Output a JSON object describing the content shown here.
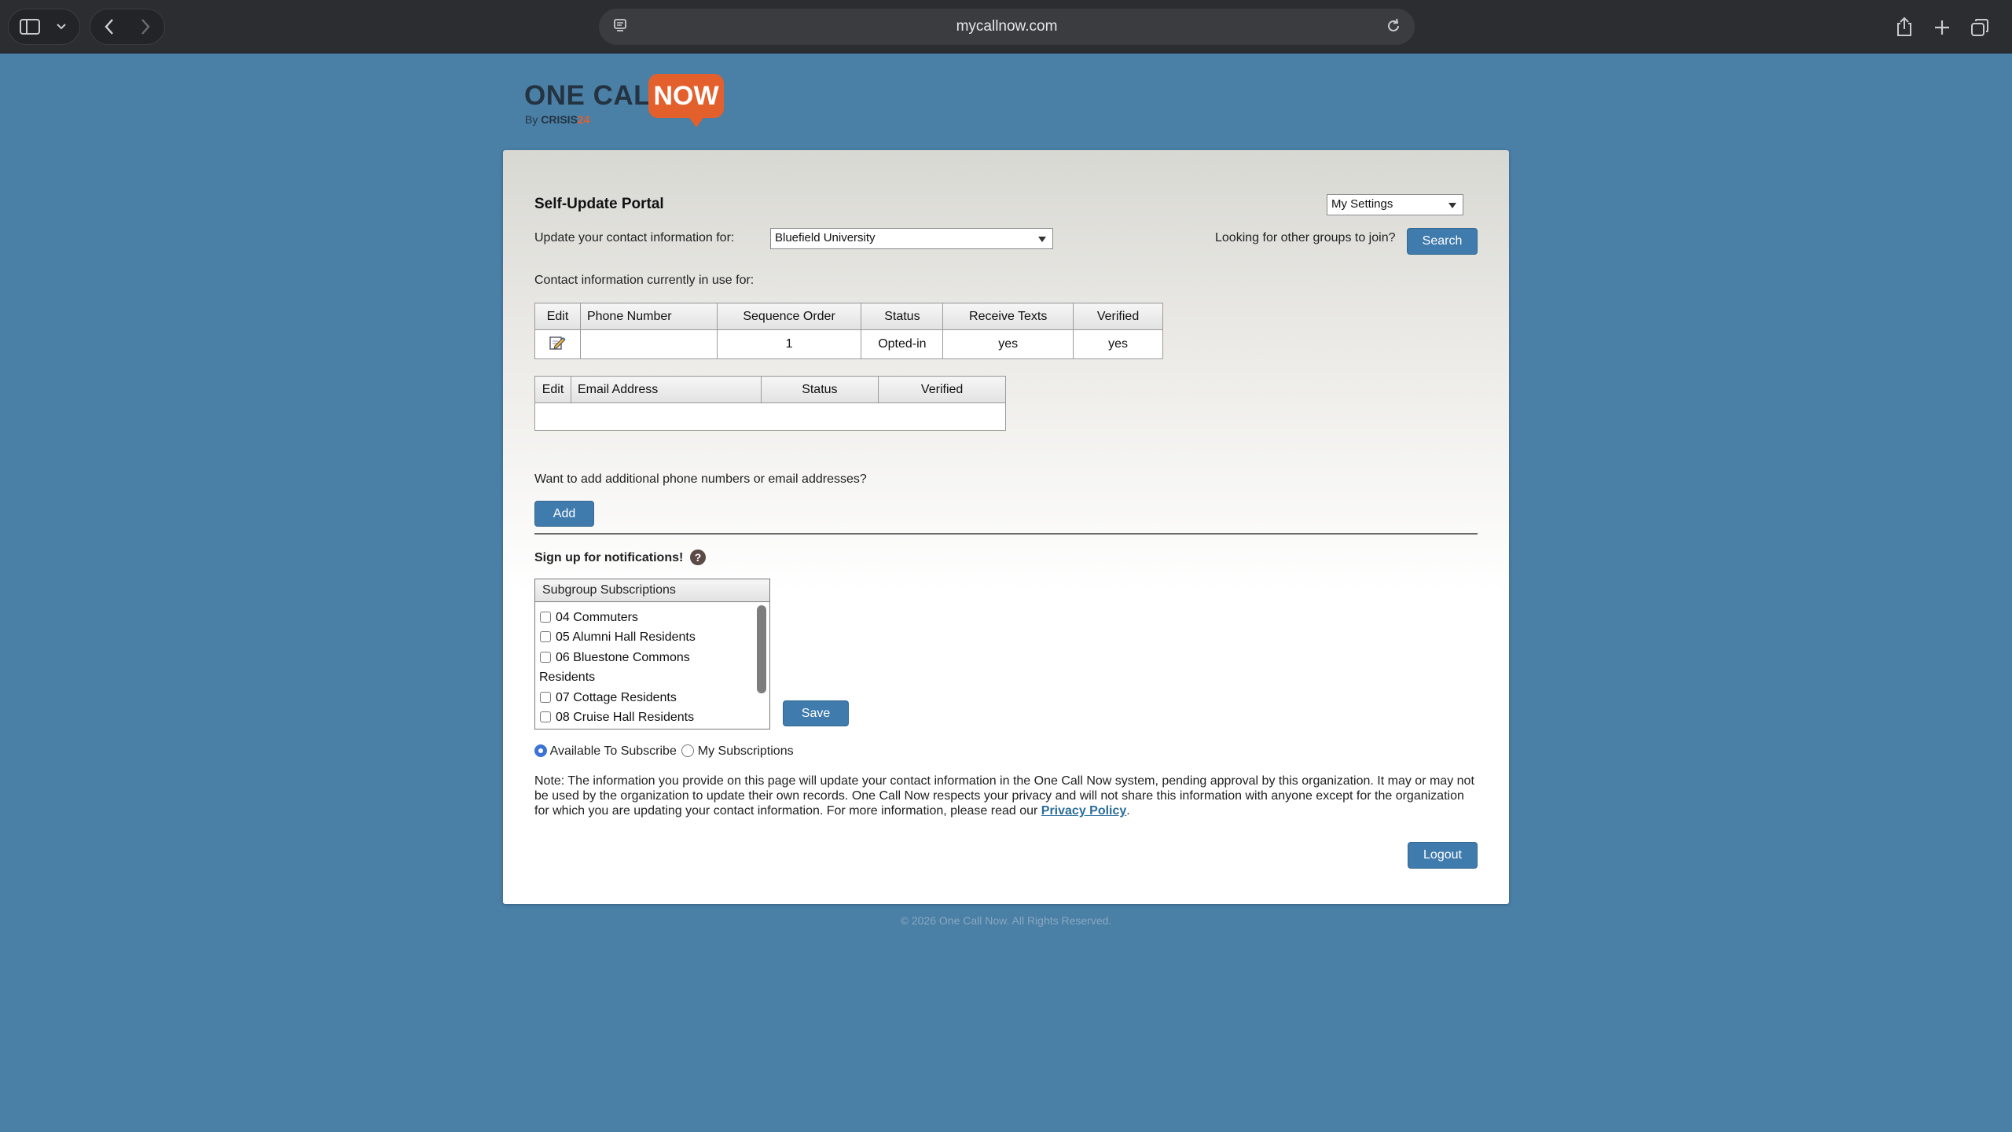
{
  "browser": {
    "url": "mycallnow.com"
  },
  "logo": {
    "text_one_call": "ONE CALL",
    "text_now": "NOW",
    "by": "By",
    "crisis": "CRISIS",
    "crisis_suffix": "24"
  },
  "portal": {
    "title": "Self-Update Portal",
    "settings_select": "My Settings",
    "update_label": "Update your contact information for:",
    "organization_select": "Bluefield University",
    "groups_prompt": "Looking for other groups to join?",
    "search_button": "Search",
    "contact_label": "Contact information currently in use for:"
  },
  "phone_table": {
    "headers": [
      "Edit",
      "Phone Number",
      "Sequence Order",
      "Status",
      "Receive Texts",
      "Verified"
    ],
    "rows": [
      {
        "phone": "",
        "sequence": "1",
        "status": "Opted-in",
        "texts": "yes",
        "verified": "yes"
      }
    ]
  },
  "email_table": {
    "headers": [
      "Edit",
      "Email Address",
      "Status",
      "Verified"
    ]
  },
  "add_section": {
    "prompt": "Want to add additional phone numbers or email addresses?",
    "add_button": "Add"
  },
  "notifications": {
    "title": "Sign up for notifications!",
    "help": "?",
    "list_header": "Subgroup Subscriptions",
    "items": [
      "04 Commuters",
      "05 Alumni Hall Residents",
      "06 Bluestone Commons",
      "07 Cottage Residents",
      "08 Cruise Hall Residents"
    ],
    "wrap_continuation": "Residents",
    "save_button": "Save",
    "filter_available": "Available To Subscribe",
    "filter_mine": "My Subscriptions"
  },
  "note": {
    "text": "Note: The information you provide on this page will update your contact information in the One Call Now system, pending approval by this organization. It may or may not be used by the organization to update their own records. One Call Now respects your privacy and will not share this information with anyone except for the organization for which you are updating your contact information. For more information, please read our ",
    "link": "Privacy Policy",
    "end": "."
  },
  "logout_button": "Logout",
  "footer": "© 2026 One Call Now. All Rights Reserved."
}
